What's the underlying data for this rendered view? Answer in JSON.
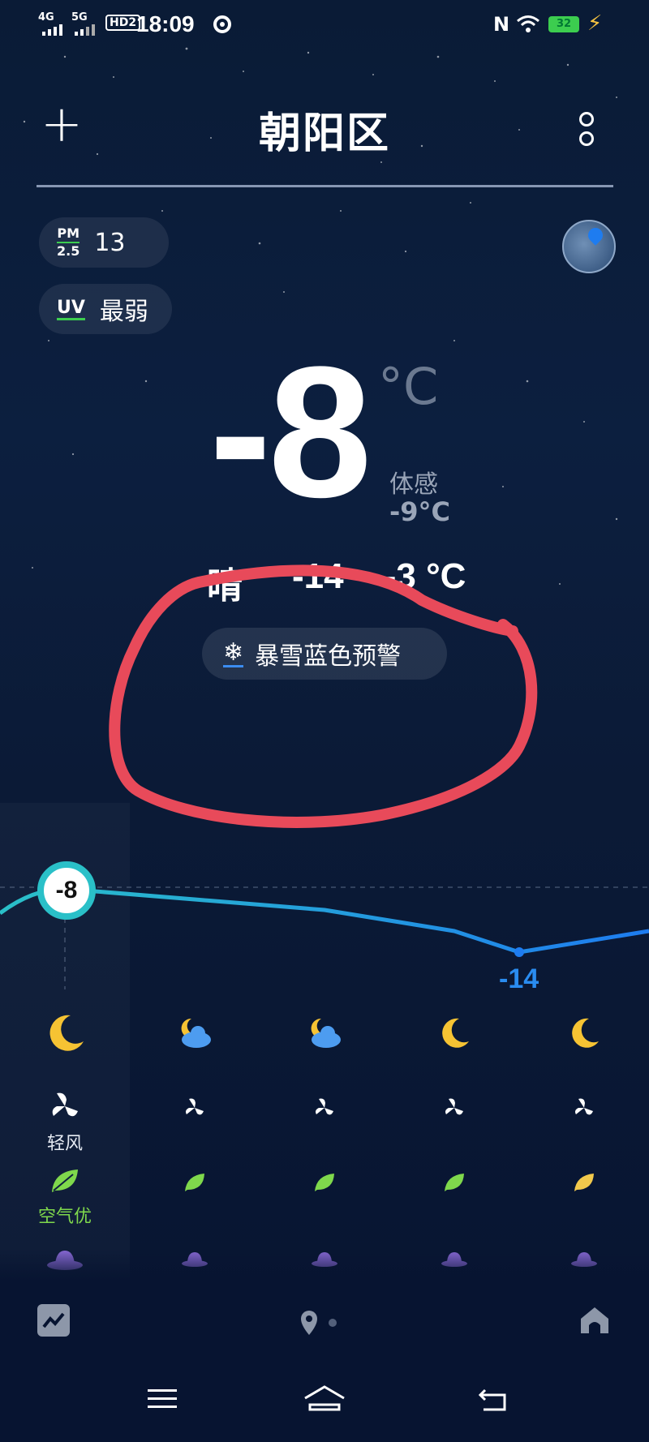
{
  "status_bar": {
    "net1": "4G",
    "net2": "5G",
    "hd": "HD2",
    "time": "18:09",
    "battery": "32",
    "nfc": "N"
  },
  "header": {
    "add_label": "+",
    "city": "朝阳区"
  },
  "badges": {
    "pm_top": "PM",
    "pm_bottom": "2.5",
    "pm_value": "13",
    "uv_label": "UV",
    "uv_value": "最弱"
  },
  "current": {
    "temp": "-8",
    "unit": "°C",
    "feels_label": "体感",
    "feels_value": "-9°C",
    "condition": "晴",
    "range": "-14 ~ -3 °C"
  },
  "alert": {
    "icon": "snowflake-icon",
    "text": "暴雪蓝色预警"
  },
  "hourly": {
    "now_temp": "-8",
    "min_temp": "-14",
    "temps": [
      -8,
      -9,
      -10,
      -12,
      -14,
      -12
    ],
    "columns": [
      {
        "weather": "moon",
        "wind_label": "轻风",
        "aq_label": "空气优",
        "leaf_color": "#7fd84c"
      },
      {
        "weather": "moon-cloud",
        "wind_label": "",
        "aq_label": "",
        "leaf_color": "#7fd84c"
      },
      {
        "weather": "moon-cloud",
        "wind_label": "",
        "aq_label": "",
        "leaf_color": "#7fd84c"
      },
      {
        "weather": "moon",
        "wind_label": "",
        "aq_label": "",
        "leaf_color": "#7fd84c"
      },
      {
        "weather": "moon",
        "wind_label": "",
        "aq_label": "",
        "leaf_color": "#f2c94c"
      }
    ]
  },
  "colors": {
    "accent_line": "#2ac0c8",
    "line_end": "#1e7cf0",
    "annotation": "#e84a5a",
    "good_air": "#7fd84c"
  }
}
